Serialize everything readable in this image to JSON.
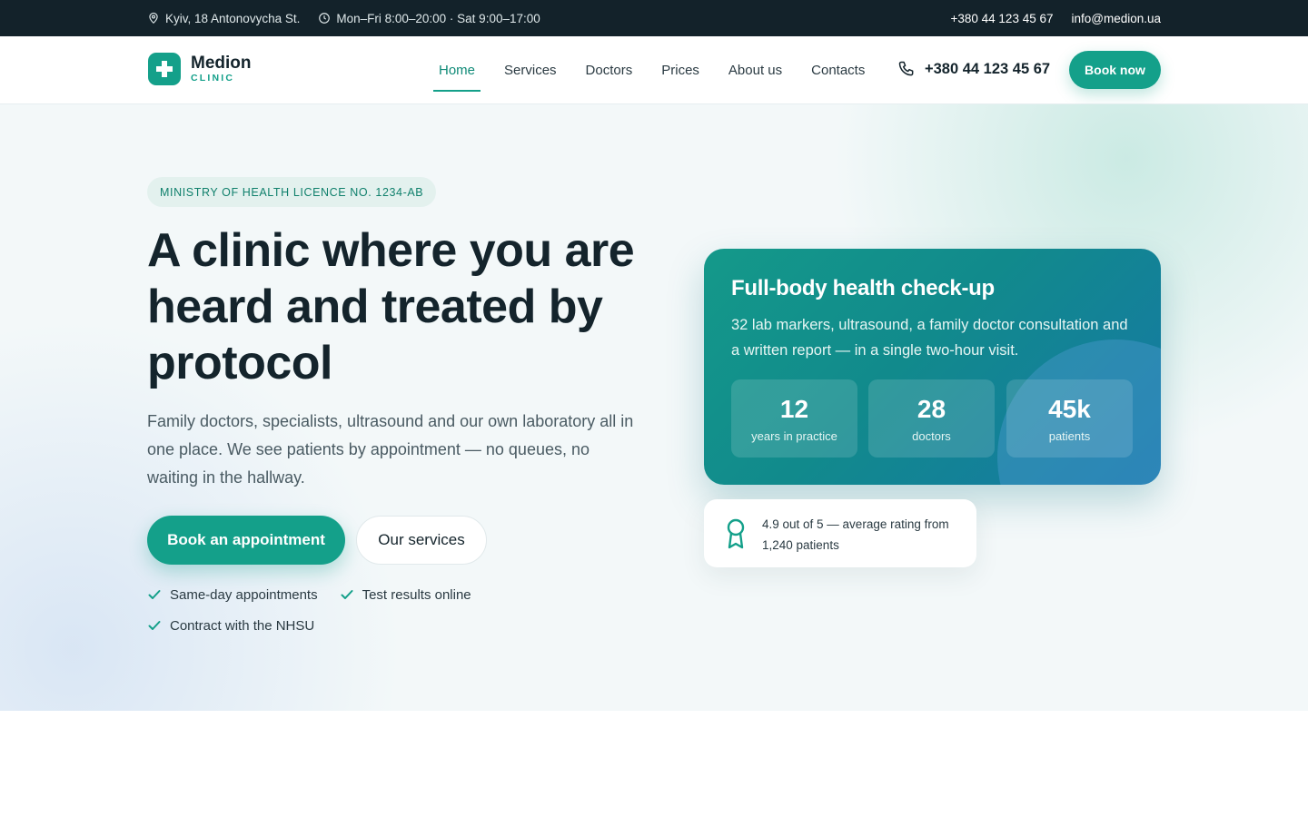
{
  "topbar": {
    "address": "Kyiv, 18 Antonovycha St.",
    "hours": "Mon–Fri 8:00–20:00 · Sat 9:00–17:00",
    "phone": "+380 44 123 45 67",
    "email": "info@medion.ua"
  },
  "header": {
    "logo_name": "Medion",
    "logo_sub": "CLINIC",
    "nav": [
      "Home",
      "Services",
      "Doctors",
      "Prices",
      "About us",
      "Contacts"
    ],
    "active_nav": "Home",
    "phone": "+380 44 123 45 67",
    "book_now": "Book now"
  },
  "hero": {
    "badge": "MINISTRY OF HEALTH LICENCE NO. 1234-AB",
    "title": "A clinic where you are heard and treated by protocol",
    "description": "Family doctors, specialists, ultrasound and our own laboratory all in one place. We see patients by appointment — no queues, no waiting in the hallway.",
    "primary_button": "Book an appointment",
    "secondary_button": "Our services",
    "features": [
      "Same-day appointments",
      "Test results online",
      "Contract with the NHSU"
    ]
  },
  "card": {
    "title": "Full-body health check-up",
    "description": "32 lab markers, ultrasound, a family doctor consultation and a written report — in a single two-hour visit.",
    "stats": [
      {
        "value": "12",
        "label": "years in practice"
      },
      {
        "value": "28",
        "label": "doctors"
      },
      {
        "value": "45k",
        "label": "patients"
      }
    ]
  },
  "rating": {
    "text": "4.9 out of 5 — average rating from 1,240 patients"
  },
  "colors": {
    "accent": "#14a08a",
    "topbar": "#13222a"
  }
}
